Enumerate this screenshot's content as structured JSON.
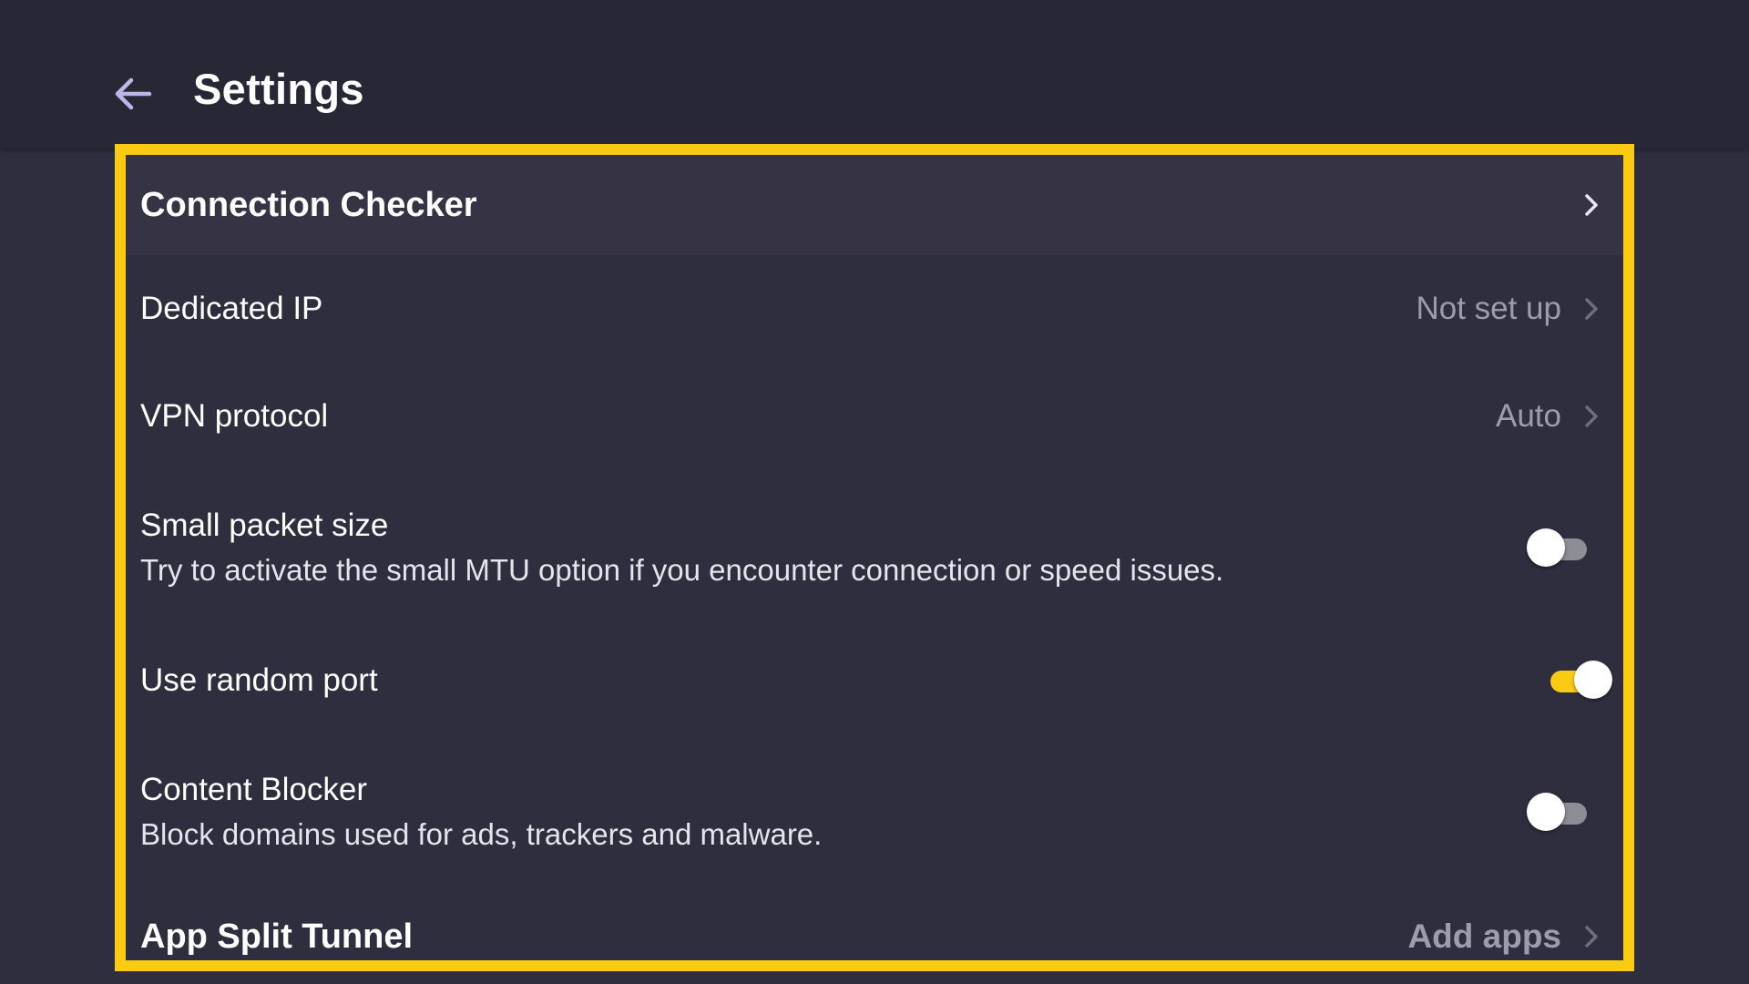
{
  "header": {
    "title": "Settings",
    "back_icon": "arrow-left-icon"
  },
  "colors": {
    "accent": "#f9cb13",
    "background": "#2e2e3e",
    "header_background": "#272736",
    "secondary_text": "#9c9cab"
  },
  "settings": {
    "connection_checker": {
      "label": "Connection Checker",
      "icon": "chevron-right-icon"
    },
    "dedicated_ip": {
      "label": "Dedicated IP",
      "value": "Not set up",
      "icon": "chevron-right-icon"
    },
    "vpn_protocol": {
      "label": "VPN protocol",
      "value": "Auto",
      "icon": "chevron-right-icon"
    },
    "small_packet_size": {
      "label": "Small packet size",
      "description": "Try to activate the small MTU option if you encounter connection or speed issues.",
      "enabled": false
    },
    "use_random_port": {
      "label": "Use random port",
      "enabled": true
    },
    "content_blocker": {
      "label": "Content Blocker",
      "description": "Block domains used for ads, trackers and malware.",
      "enabled": false
    },
    "app_split_tunnel": {
      "label": "App Split Tunnel",
      "value": "Add apps",
      "icon": "chevron-right-icon"
    }
  }
}
